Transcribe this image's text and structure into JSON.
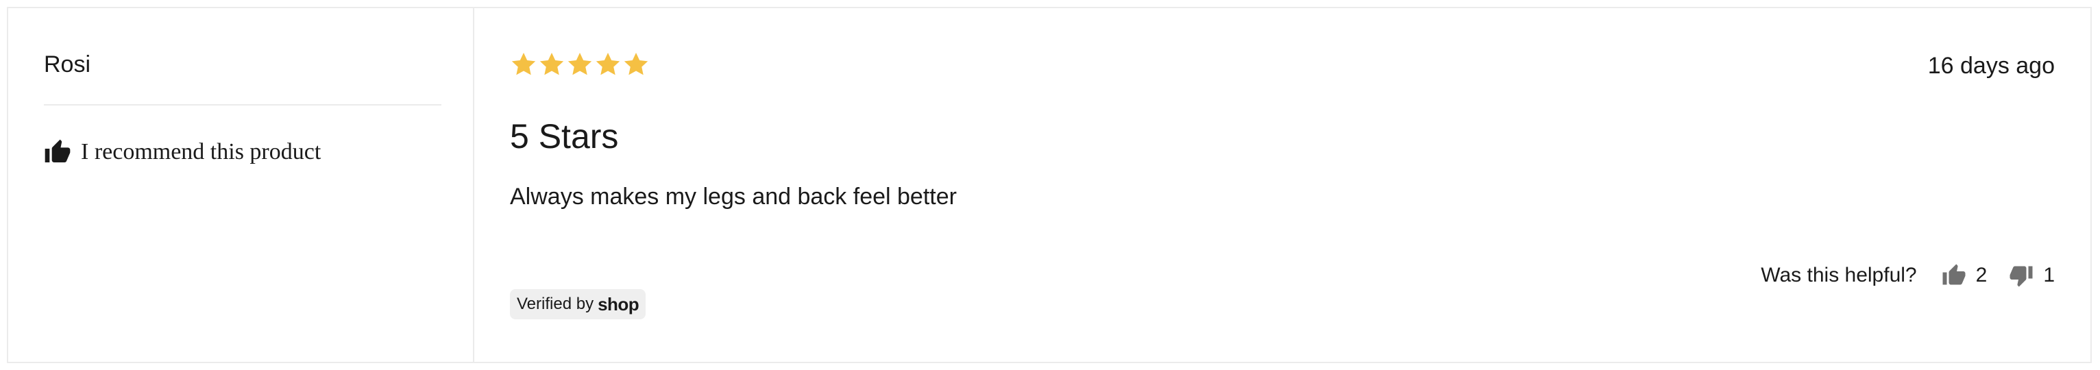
{
  "review": {
    "author": "Rosi",
    "recommend_text": "I recommend this product",
    "rating": 5,
    "rating_max": 5,
    "date": "16 days ago",
    "title": "5 Stars",
    "body": "Always makes my legs and back feel better",
    "verified_prefix": "Verified by",
    "verified_brand": "shop",
    "helpful_label": "Was this helpful?",
    "helpful_up_count": "2",
    "helpful_down_count": "1"
  },
  "colors": {
    "star": "#f5c043",
    "icon_dark": "#1a1a1a",
    "vote_icon": "#707070",
    "border": "#ebebeb",
    "badge_bg": "#efefef"
  },
  "icons": {
    "recommend": "thumbs-up-icon",
    "star": "star-icon",
    "vote_up": "thumbs-up-icon",
    "vote_down": "thumbs-down-icon"
  }
}
